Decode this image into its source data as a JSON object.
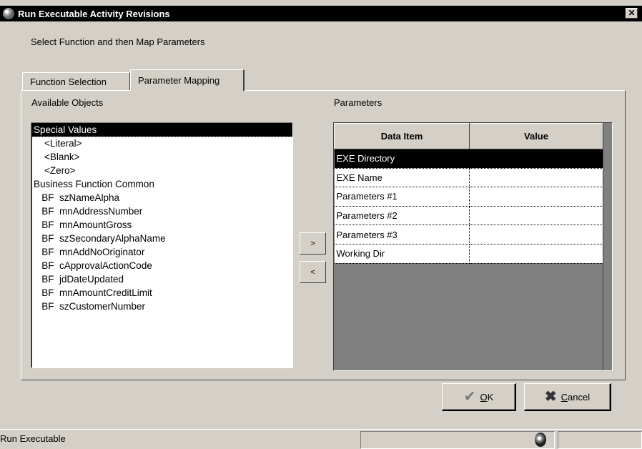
{
  "window": {
    "title": "Run Executable Activity Revisions",
    "close_label": "✕"
  },
  "instruction": "Select Function and then Map Parameters",
  "tabs": [
    {
      "label": "Function Selection",
      "active": false
    },
    {
      "label": "Parameter Mapping",
      "active": true
    }
  ],
  "available_objects": {
    "label": "Available Objects",
    "items": [
      {
        "text": "Special Values",
        "selected": true
      },
      {
        "text": "    <Literal>"
      },
      {
        "text": "    <Blank>"
      },
      {
        "text": "    <Zero>"
      },
      {
        "text": "Business Function Common"
      },
      {
        "text": "   BF  szNameAlpha"
      },
      {
        "text": "   BF  mnAddressNumber"
      },
      {
        "text": "   BF  mnAmountGross"
      },
      {
        "text": "   BF  szSecondaryAlphaName"
      },
      {
        "text": "   BF  mnAddNoOriginator"
      },
      {
        "text": "   BF  cApprovalActionCode"
      },
      {
        "text": "   BF  jdDateUpdated"
      },
      {
        "text": "   BF  mnAmountCreditLimit"
      },
      {
        "text": "   BF  szCustomerNumber"
      }
    ]
  },
  "move_buttons": {
    "add": ">",
    "remove": "<"
  },
  "parameters": {
    "label": "Parameters",
    "columns": [
      "Data Item",
      "Value"
    ],
    "rows": [
      {
        "data_item": "EXE Directory",
        "value": "",
        "selected": true
      },
      {
        "data_item": "EXE Name",
        "value": ""
      },
      {
        "data_item": "Parameters #1",
        "value": ""
      },
      {
        "data_item": "Parameters #2",
        "value": ""
      },
      {
        "data_item": "Parameters #3",
        "value": ""
      },
      {
        "data_item": "Working Dir",
        "value": ""
      }
    ]
  },
  "buttons": {
    "ok": {
      "mnemonic": "O",
      "rest": "K",
      "icon": "check-icon"
    },
    "cancel": {
      "mnemonic": "C",
      "rest": "ancel",
      "icon": "x-icon"
    }
  },
  "status": {
    "text": "Run Executable"
  }
}
